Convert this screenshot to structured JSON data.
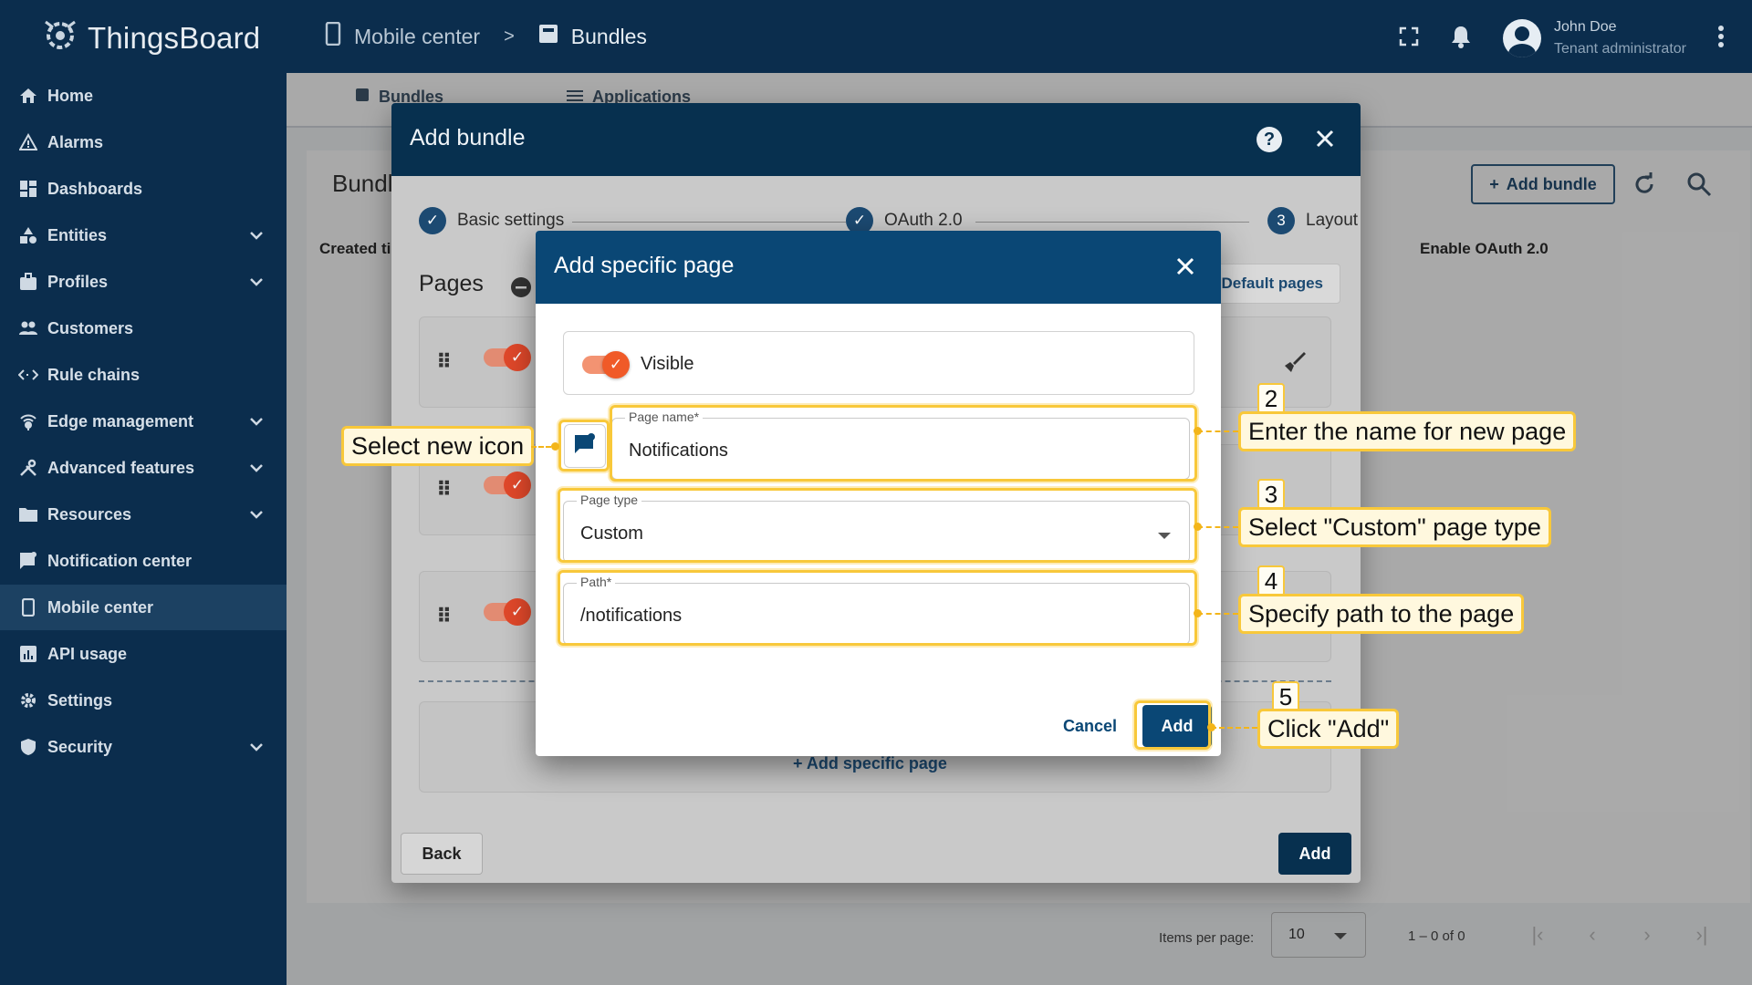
{
  "app": {
    "logo_text": "ThingsBoard",
    "breadcrumb": [
      "Mobile center",
      "Bundles"
    ],
    "breadcrumb_sep": ">",
    "user_name": "John Doe",
    "user_role": "Tenant administrator"
  },
  "sidebar": {
    "items": [
      {
        "label": "Home",
        "icon": "home-icon"
      },
      {
        "label": "Alarms",
        "icon": "warning-icon"
      },
      {
        "label": "Dashboards",
        "icon": "dashboard-icon"
      },
      {
        "label": "Entities",
        "icon": "shapes-icon",
        "expandable": true
      },
      {
        "label": "Profiles",
        "icon": "badge-icon",
        "expandable": true
      },
      {
        "label": "Customers",
        "icon": "people-icon"
      },
      {
        "label": "Rule chains",
        "icon": "code-icon"
      },
      {
        "label": "Edge management",
        "icon": "router-icon",
        "expandable": true
      },
      {
        "label": "Advanced features",
        "icon": "tools-icon",
        "expandable": true
      },
      {
        "label": "Resources",
        "icon": "folder-icon",
        "expandable": true
      },
      {
        "label": "Notification center",
        "icon": "notification-icon"
      },
      {
        "label": "Mobile center",
        "icon": "phone-icon",
        "active": true
      },
      {
        "label": "API usage",
        "icon": "chart-icon"
      },
      {
        "label": "Settings",
        "icon": "gear-icon"
      },
      {
        "label": "Security",
        "icon": "shield-icon",
        "expandable": true
      }
    ]
  },
  "background": {
    "tabs": [
      "Bundles",
      "Applications"
    ],
    "card_title": "Bundles",
    "col_created": "Created time",
    "col_oauth": "Enable OAuth 2.0",
    "add_bundle": "Add bundle",
    "items_per_page_label": "Items per page:",
    "items_per_page_value": "10",
    "range": "1 – 0 of 0"
  },
  "outer_dialog": {
    "title": "Add bundle",
    "help": "?",
    "steps": [
      {
        "label": "Basic settings",
        "state": "done"
      },
      {
        "label": "OAuth 2.0",
        "state": "done"
      },
      {
        "label": "Layout",
        "state": "current",
        "number": "3"
      }
    ],
    "pages_title": "Pages",
    "default_pages": "Default pages",
    "add_specific_page": "Add specific page",
    "back": "Back",
    "add": "Add"
  },
  "inner_dialog": {
    "title": "Add specific page",
    "visible_label": "Visible",
    "visible_on": true,
    "page_name_label": "Page name*",
    "page_name_value": "Notifications",
    "page_type_label": "Page type",
    "page_type_value": "Custom",
    "path_label": "Path*",
    "path_value": "/notifications",
    "cancel": "Cancel",
    "add": "Add"
  },
  "annotations": {
    "icon_callout": "Select new icon",
    "step2_num": "2",
    "step2_text": "Enter the name for new page",
    "step3_num": "3",
    "step3_text": "Select \"Custom\" page type",
    "step4_num": "4",
    "step4_text": "Specify path to the page",
    "step5_num": "5",
    "step5_text": "Click \"Add\"",
    "highlight_color": "#f8c83a"
  }
}
